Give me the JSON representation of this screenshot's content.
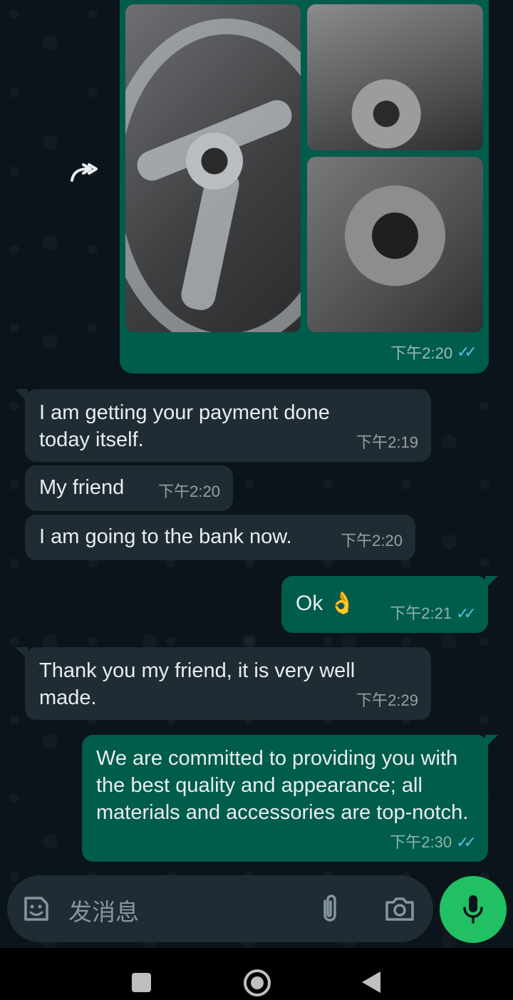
{
  "media_message": {
    "time": "下午2:20",
    "status": "read"
  },
  "messages": [
    {
      "direction": "incoming",
      "text": "I am getting your payment done today itself.",
      "time": "下午2:19"
    },
    {
      "direction": "incoming",
      "text": "My friend",
      "time": "下午2:20"
    },
    {
      "direction": "incoming",
      "text": "I am going to the bank now.",
      "time": "下午2:20"
    },
    {
      "direction": "outgoing",
      "text": "Ok 👌",
      "time": "下午2:21",
      "status": "read"
    },
    {
      "direction": "incoming",
      "text": "Thank you my friend, it is very well made.",
      "time": "下午2:29"
    },
    {
      "direction": "outgoing",
      "text": "We are committed to providing you with the best quality and appearance; all materials and accessories are top-notch.",
      "time": "下午2:30",
      "status": "read"
    }
  ],
  "input": {
    "placeholder": "发消息"
  },
  "icons": {
    "forward": "forward-icon",
    "sticker": "sticker-icon",
    "attach": "paperclip-icon",
    "camera": "camera-icon",
    "mic": "microphone-icon",
    "read_ticks": "double-check-icon"
  },
  "colors": {
    "background": "#0b141a",
    "incoming_bubble": "#202c33",
    "outgoing_bubble": "#005c4b",
    "read_tick": "#53bdeb",
    "mic_button": "#21c063"
  },
  "read_marker": "✓✓"
}
